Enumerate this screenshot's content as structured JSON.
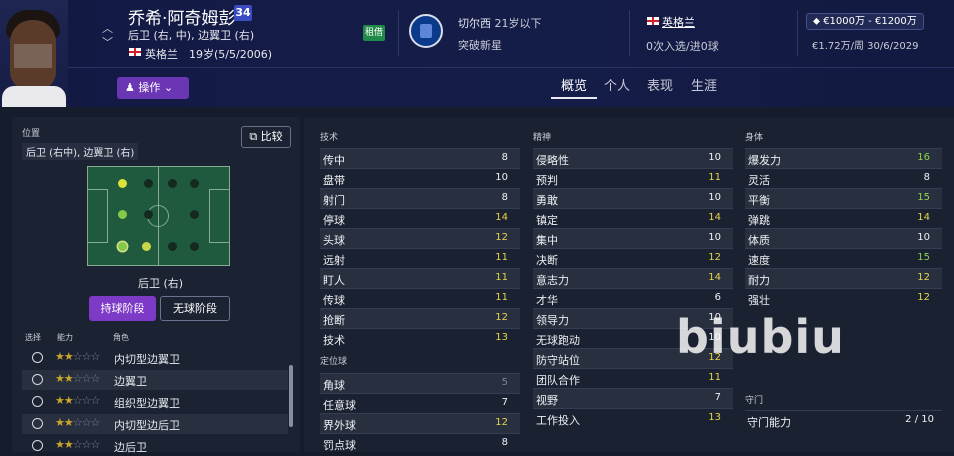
{
  "player": {
    "name": "乔希·阿奇姆彭",
    "number": "34",
    "positions": "后卫 (右, 中), 边翼卫 (右)",
    "nationality": "英格兰",
    "age": "19岁(5/5/2006)",
    "loan_badge": "租借"
  },
  "club": {
    "name": "切尔西",
    "squad": "21岁以下",
    "status": "突破新星"
  },
  "intl": {
    "country": "英格兰",
    "caps": "0次入选/进0球"
  },
  "contract": {
    "value": "€1000万 - €1200万",
    "wage_expiry": "€1.72万/周  30/6/2029"
  },
  "actions": {
    "action_label": "操作"
  },
  "tabs": [
    "概览",
    "个人",
    "表现",
    "生涯"
  ],
  "left": {
    "position_label": "位置",
    "position_value": "后卫 (右中), 边翼卫 (右)",
    "compare": "比较",
    "current_role": "后卫 (右)",
    "phase_in": "持球阶段",
    "phase_out": "无球阶段",
    "col_select": "选择",
    "col_ability": "能力",
    "col_role": "角色",
    "roles": [
      {
        "stars": 2,
        "name": "内切型边翼卫"
      },
      {
        "stars": 2,
        "name": "边翼卫"
      },
      {
        "stars": 2,
        "name": "组织型边翼卫"
      },
      {
        "stars": 2,
        "name": "内切型边后卫"
      },
      {
        "stars": 2,
        "name": "边后卫"
      }
    ]
  },
  "technical": {
    "title": "技术",
    "items": [
      {
        "n": "传中",
        "v": "8"
      },
      {
        "n": "盘带",
        "v": "10"
      },
      {
        "n": "射门",
        "v": "8"
      },
      {
        "n": "停球",
        "v": "14"
      },
      {
        "n": "头球",
        "v": "12"
      },
      {
        "n": "远射",
        "v": "11"
      },
      {
        "n": "盯人",
        "v": "11"
      },
      {
        "n": "传球",
        "v": "11"
      },
      {
        "n": "抢断",
        "v": "12"
      },
      {
        "n": "技术",
        "v": "13"
      }
    ]
  },
  "set_pieces": {
    "title": "定位球",
    "items": [
      {
        "n": "角球",
        "v": "5"
      },
      {
        "n": "任意球",
        "v": "7"
      },
      {
        "n": "界外球",
        "v": "12"
      },
      {
        "n": "罚点球",
        "v": "8"
      }
    ]
  },
  "mental": {
    "title": "精神",
    "items": [
      {
        "n": "侵略性",
        "v": "10"
      },
      {
        "n": "预判",
        "v": "11"
      },
      {
        "n": "勇敢",
        "v": "10"
      },
      {
        "n": "镇定",
        "v": "14"
      },
      {
        "n": "集中",
        "v": "10"
      },
      {
        "n": "决断",
        "v": "12"
      },
      {
        "n": "意志力",
        "v": "14"
      },
      {
        "n": "才华",
        "v": "6"
      },
      {
        "n": "领导力",
        "v": "10"
      },
      {
        "n": "无球跑动",
        "v": "10"
      },
      {
        "n": "防守站位",
        "v": "12"
      },
      {
        "n": "团队合作",
        "v": "11"
      },
      {
        "n": "视野",
        "v": "7"
      },
      {
        "n": "工作投入",
        "v": "13"
      }
    ]
  },
  "physical": {
    "title": "身体",
    "items": [
      {
        "n": "爆发力",
        "v": "16"
      },
      {
        "n": "灵活",
        "v": "8"
      },
      {
        "n": "平衡",
        "v": "15"
      },
      {
        "n": "弹跳",
        "v": "14"
      },
      {
        "n": "体质",
        "v": "10"
      },
      {
        "n": "速度",
        "v": "15"
      },
      {
        "n": "耐力",
        "v": "12"
      },
      {
        "n": "强壮",
        "v": "12"
      }
    ]
  },
  "goalkeeping": {
    "title": "守门",
    "ability_label": "守门能力",
    "ability_value": "2 / 10"
  },
  "watermark": "biubiu",
  "colors": {
    "header": "#141c48",
    "panel": "#1b2232",
    "accent_purple": "#7d3ac6",
    "attr_green": "#8fd14f",
    "attr_yellow": "#e5d34a"
  }
}
